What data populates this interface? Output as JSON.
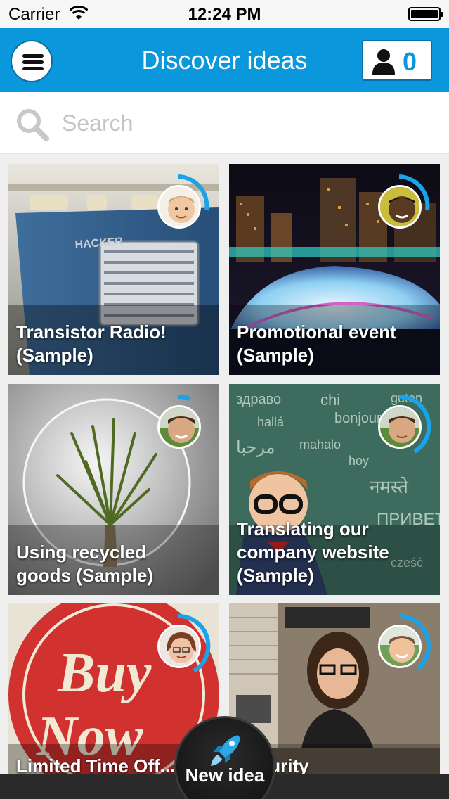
{
  "status_bar": {
    "carrier": "Carrier",
    "time": "12:24 PM"
  },
  "nav": {
    "title": "Discover ideas",
    "user_count": "0"
  },
  "search": {
    "placeholder": "Search"
  },
  "ideas": [
    {
      "title_line1": "Transistor Radio!",
      "title_line2": "(Sample)",
      "image": "vintage-blue-radio",
      "progress": 0.3
    },
    {
      "title_line1": "Promotional event",
      "title_line2": "(Sample)",
      "image": "night-city-event",
      "progress": 0.3
    },
    {
      "title_line1": "Using recycled",
      "title_line2": "goods (Sample)",
      "image": "plant-in-lightbulb",
      "progress": 0.05
    },
    {
      "title_line1": "Translating our",
      "title_line2": "company website",
      "title_line3": "(Sample)",
      "image": "boy-chalkboard-languages",
      "progress": 0.4
    },
    {
      "title_line1": "Limited Time Off...",
      "image": "buy-now-sign",
      "progress": 0.4
    },
    {
      "title_line1": "Security",
      "image": "woman-at-desk",
      "progress": 0.45
    }
  ],
  "fab": {
    "label": "New idea"
  },
  "colors": {
    "accent": "#0a97dc",
    "ring": "#1aa3e8"
  }
}
